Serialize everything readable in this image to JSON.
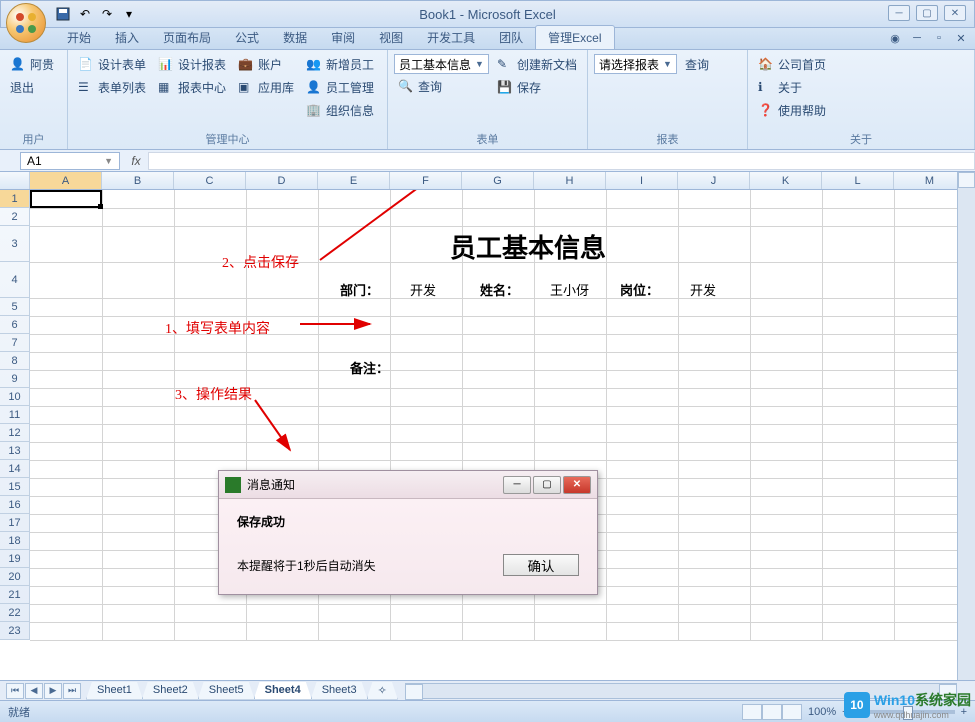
{
  "window": {
    "title": "Book1 - Microsoft Excel"
  },
  "tabs": {
    "items": [
      "开始",
      "插入",
      "页面布局",
      "公式",
      "数据",
      "审阅",
      "视图",
      "开发工具",
      "团队",
      "管理Excel"
    ],
    "active": "管理Excel"
  },
  "ribbon": {
    "groups": {
      "user": {
        "label": "用户",
        "btn1": "阿贵",
        "btn2": "退出"
      },
      "center": {
        "label": "管理中心",
        "c1a": "设计表单",
        "c1b": "表单列表",
        "c2a": "设计报表",
        "c2b": "报表中心",
        "c3a": "账户",
        "c3b": "应用库",
        "c4a": "新增员工",
        "c4b": "员工管理",
        "c4c": "组织信息"
      },
      "form": {
        "label": "表单",
        "combo": "员工基本信息",
        "b1": "查询",
        "c1": "创建新文档",
        "c2": "保存"
      },
      "report": {
        "label": "报表",
        "combo": "请选择报表",
        "b1": "查询"
      },
      "about": {
        "label": "关于",
        "b1": "公司首页",
        "b2": "关于",
        "b3": "使用帮助"
      }
    }
  },
  "namebox": "A1",
  "columns": [
    "A",
    "B",
    "C",
    "D",
    "E",
    "F",
    "G",
    "H",
    "I",
    "J",
    "K",
    "L",
    "M"
  ],
  "rows": [
    "1",
    "2",
    "3",
    "4",
    "5",
    "6",
    "7",
    "8",
    "9",
    "10",
    "11",
    "12",
    "13",
    "14",
    "15",
    "16",
    "17",
    "18",
    "19",
    "20",
    "21",
    "22",
    "23"
  ],
  "sheet": {
    "title": "员工基本信息",
    "dept_lbl": "部门：",
    "dept_val": "开发",
    "name_lbl": "姓名：",
    "name_val": "王小伢",
    "post_lbl": "岗位：",
    "post_val": "开发",
    "remark_lbl": "备注："
  },
  "annotations": {
    "a1": "1、填写表单内容",
    "a2": "2、点击保存",
    "a3": "3、操作结果"
  },
  "dialog": {
    "title": "消息通知",
    "msg1": "保存成功",
    "msg2": "本提醒将于1秒后自动消失",
    "ok": "确认"
  },
  "sheets": {
    "items": [
      "Sheet1",
      "Sheet2",
      "Sheet5",
      "Sheet4",
      "Sheet3"
    ],
    "active": "Sheet4"
  },
  "status": {
    "ready": "就绪",
    "zoom": "100%"
  },
  "watermark": {
    "badge": "10",
    "line1a": "Win10",
    "line1b": "系统家园",
    "line2": "www.qdhuajin.com"
  }
}
